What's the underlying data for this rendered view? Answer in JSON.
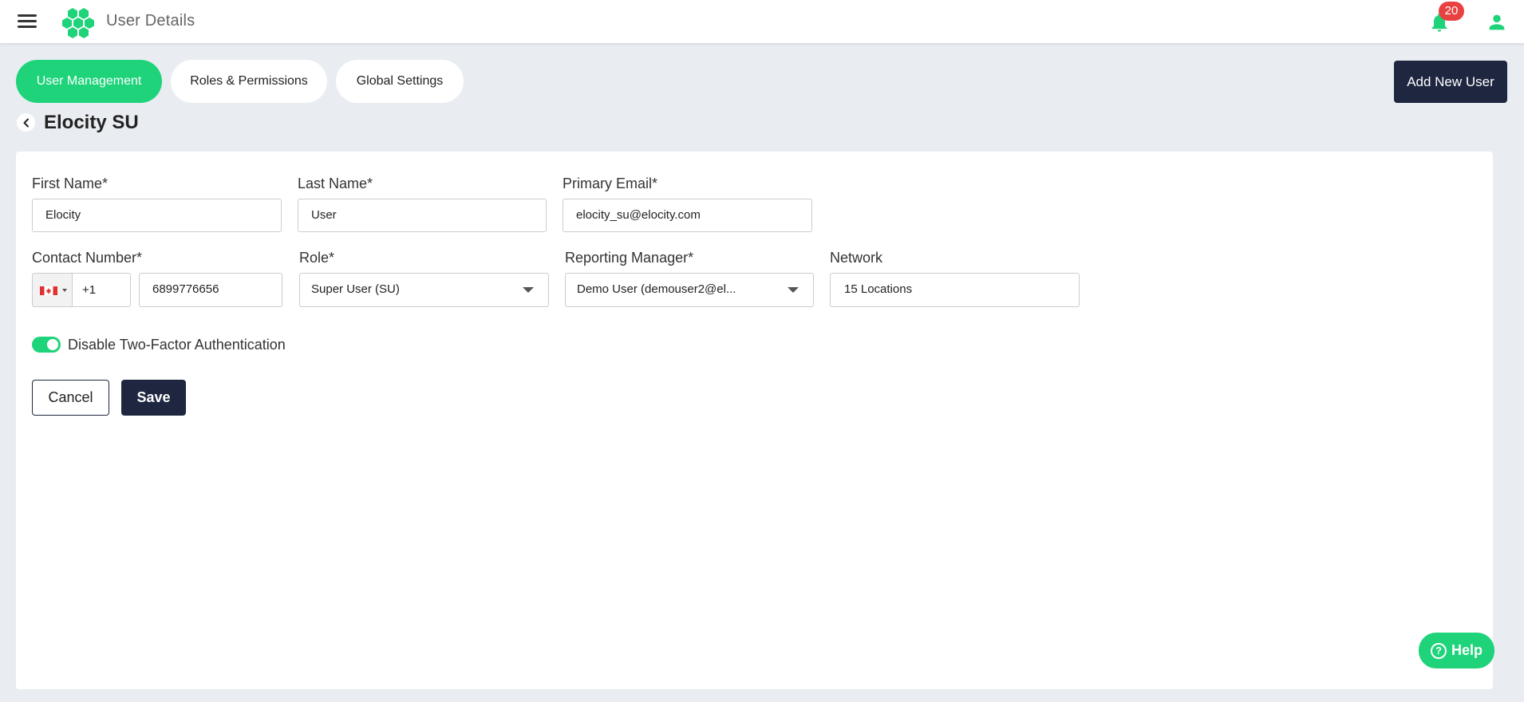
{
  "header": {
    "title": "User Details",
    "notification_count": "20",
    "icons": {
      "menu": "hamburger-menu-icon",
      "logo": "hexagon-logo",
      "notifications": "bell-icon",
      "account": "user-icon"
    }
  },
  "tabs": [
    {
      "label": "User Management",
      "active": true
    },
    {
      "label": "Roles & Permissions",
      "active": false
    },
    {
      "label": "Global Settings",
      "active": false
    }
  ],
  "add_user_label": "Add New User",
  "page": {
    "title": "Elocity SU"
  },
  "form": {
    "first_name": {
      "label": "First Name*",
      "value": "Elocity"
    },
    "last_name": {
      "label": "Last Name*",
      "value": "User"
    },
    "primary_email": {
      "label": "Primary Email*",
      "value": "elocity_su@elocity.com"
    },
    "contact_number": {
      "label": "Contact Number*",
      "country": "Canada",
      "dial_code": "+1",
      "value": "6899776656"
    },
    "role": {
      "label": "Role*",
      "value": "Super User (SU)"
    },
    "reporting_manager": {
      "label": "Reporting Manager*",
      "value": "Demo User (demouser2@el..."
    },
    "network": {
      "label": "Network",
      "value": "15 Locations"
    },
    "two_factor": {
      "label": "Disable Two-Factor Authentication",
      "enabled": true
    },
    "cancel_label": "Cancel",
    "save_label": "Save"
  },
  "help_label": "Help",
  "colors": {
    "accent": "#1ed37a",
    "dark": "#1e2640",
    "badge": "#e84141",
    "background": "#e9edf2"
  }
}
